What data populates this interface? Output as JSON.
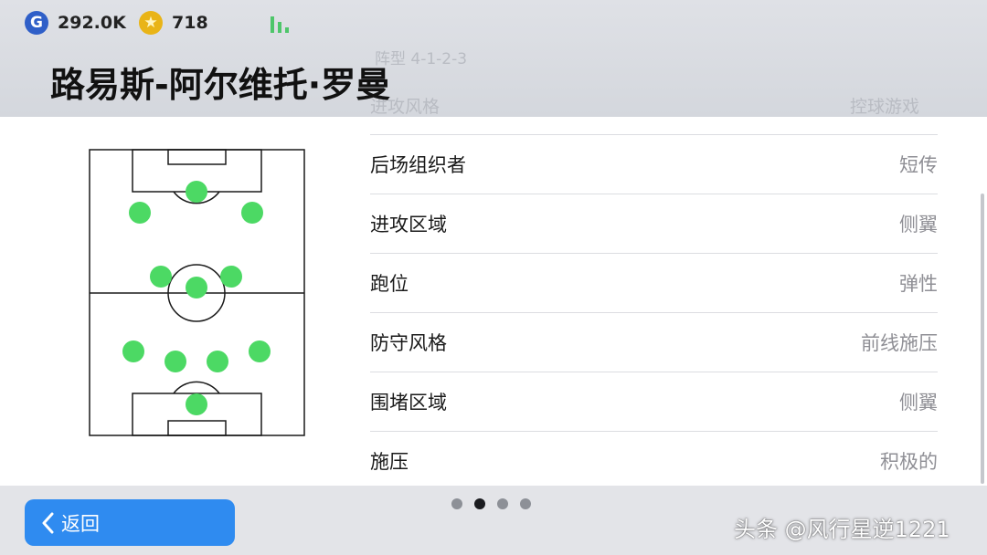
{
  "header": {
    "gp": {
      "icon": "g-coin-icon",
      "letter": "G",
      "value": "292.0K"
    },
    "coins": {
      "icon": "star-coin-icon",
      "star": "★",
      "value": "718"
    },
    "signal_icon": "signal-bars-icon",
    "player_name": "路易斯-阿尔维托·罗曼",
    "ghost_formation": "阵型 4-1-2-3",
    "ghost_label": "进攻风格",
    "ghost_value": "控球游戏"
  },
  "formation": {
    "dot_color": "#4cd964",
    "line_color": "#1a1a1a"
  },
  "tactics": [
    {
      "label": "后场组织者",
      "value": "短传"
    },
    {
      "label": "进攻区域",
      "value": "侧翼"
    },
    {
      "label": "跑位",
      "value": "弹性"
    },
    {
      "label": "防守风格",
      "value": "前线施压"
    },
    {
      "label": "围堵区域",
      "value": "侧翼"
    },
    {
      "label": "施压",
      "value": "积极的"
    }
  ],
  "footer": {
    "back_label": "返回",
    "back_icon": "chevron-left-icon",
    "pages": 4,
    "active_page": 2,
    "watermark": "头条 @风行星逆1221"
  },
  "colors": {
    "accent": "#2f8bf0",
    "header_bg": "#d9dbe0",
    "footer_bg": "#e3e4e8"
  }
}
